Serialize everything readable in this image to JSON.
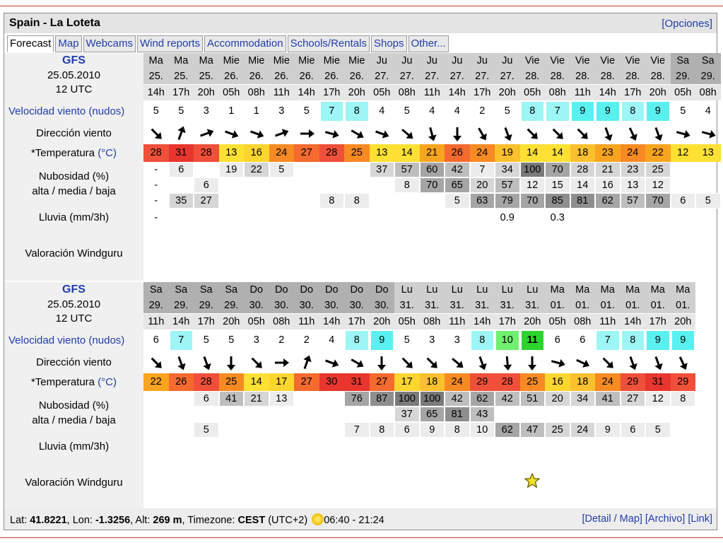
{
  "page": {
    "title": "Spain - La Loteta",
    "options_link": "[Opciones]"
  },
  "tabs": [
    "Forecast",
    "Map",
    "Webcams",
    "Wind reports",
    "Accommodation",
    "Schools/Rentals",
    "Shops",
    "Other..."
  ],
  "labels": {
    "speed": "Velocidad viento (nudos)",
    "direction": "Dirección viento",
    "temp_prefix": "*Temperatura ",
    "temp_unit": "(°C)",
    "cloud1": "Nubosidad (%)",
    "cloud2": "alta / media / baja",
    "rain": "Lluvia (mm/3h)",
    "rating": "Valoración Windguru"
  },
  "colors": {
    "link": "#1f3cab",
    "header_weekday": "#cfcfcf",
    "header_weekend": "#b0b0b0",
    "label_bg": "#f0f0f0"
  },
  "blocks": [
    {
      "model": "GFS",
      "date": "25.05.2010",
      "utc": "12 UTC",
      "cols": [
        {
          "day": "Ma",
          "date": "25.",
          "hour": "14h",
          "we": false
        },
        {
          "day": "Ma",
          "date": "25.",
          "hour": "17h",
          "we": false
        },
        {
          "day": "Ma",
          "date": "25.",
          "hour": "20h",
          "we": false
        },
        {
          "day": "Mie",
          "date": "26.",
          "hour": "05h",
          "we": false
        },
        {
          "day": "Mie",
          "date": "26.",
          "hour": "08h",
          "we": false
        },
        {
          "day": "Mie",
          "date": "26.",
          "hour": "11h",
          "we": false
        },
        {
          "day": "Mie",
          "date": "26.",
          "hour": "14h",
          "we": false
        },
        {
          "day": "Mie",
          "date": "26.",
          "hour": "17h",
          "we": false
        },
        {
          "day": "Mie",
          "date": "26.",
          "hour": "20h",
          "we": false
        },
        {
          "day": "Ju",
          "date": "27.",
          "hour": "05h",
          "we": false
        },
        {
          "day": "Ju",
          "date": "27.",
          "hour": "08h",
          "we": false
        },
        {
          "day": "Ju",
          "date": "27.",
          "hour": "11h",
          "we": false
        },
        {
          "day": "Ju",
          "date": "27.",
          "hour": "14h",
          "we": false
        },
        {
          "day": "Ju",
          "date": "27.",
          "hour": "17h",
          "we": false
        },
        {
          "day": "Ju",
          "date": "27.",
          "hour": "20h",
          "we": false
        },
        {
          "day": "Vie",
          "date": "28.",
          "hour": "05h",
          "we": false
        },
        {
          "day": "Vie",
          "date": "28.",
          "hour": "08h",
          "we": false
        },
        {
          "day": "Vie",
          "date": "28.",
          "hour": "11h",
          "we": false
        },
        {
          "day": "Vie",
          "date": "28.",
          "hour": "14h",
          "we": false
        },
        {
          "day": "Vie",
          "date": "28.",
          "hour": "17h",
          "we": false
        },
        {
          "day": "Vie",
          "date": "28.",
          "hour": "20h",
          "we": false
        },
        {
          "day": "Sa",
          "date": "29.",
          "hour": "05h",
          "we": true
        },
        {
          "day": "Sa",
          "date": "29.",
          "hour": "08h",
          "we": true
        }
      ],
      "speed": [
        "5",
        "5",
        "3",
        "1",
        "1",
        "3",
        "5",
        "7",
        "8",
        "4",
        "5",
        "4",
        "4",
        "2",
        "5",
        "8",
        "7",
        "9",
        "9",
        "8",
        "9",
        "5",
        "4"
      ],
      "dir": [
        135,
        20,
        70,
        110,
        110,
        70,
        90,
        105,
        120,
        110,
        130,
        165,
        180,
        150,
        160,
        135,
        135,
        135,
        160,
        155,
        160,
        105,
        105
      ],
      "temp": [
        "28",
        "31",
        "28",
        "13",
        "16",
        "24",
        "27",
        "28",
        "25",
        "13",
        "14",
        "21",
        "26",
        "24",
        "19",
        "14",
        "14",
        "18",
        "23",
        "24",
        "22",
        "12",
        "13"
      ],
      "cloud_high": [
        "-",
        "6",
        "",
        "19",
        "22",
        "5",
        "",
        "",
        "",
        "37",
        "57",
        "60",
        "42",
        "7",
        "34",
        "100",
        "70",
        "28",
        "21",
        "23",
        "25",
        "",
        ""
      ],
      "cloud_mid": [
        "-",
        "",
        "6",
        "",
        "",
        "",
        "",
        "",
        "",
        "",
        "8",
        "70",
        "65",
        "20",
        "57",
        "12",
        "15",
        "14",
        "16",
        "13",
        "12",
        "",
        ""
      ],
      "cloud_low": [
        "-",
        "35",
        "27",
        "",
        "",
        "",
        "",
        "8",
        "8",
        "",
        "",
        "",
        "5",
        "63",
        "79",
        "70",
        "85",
        "81",
        "62",
        "57",
        "70",
        "6",
        "5"
      ],
      "rain": [
        "-",
        "",
        "",
        "",
        "",
        "",
        "",
        "",
        "",
        "",
        "",
        "",
        "",
        "",
        "0.9",
        "",
        "0.3",
        "",
        "",
        "",
        "",
        "",
        ""
      ],
      "rating": [
        "",
        "",
        "",
        "",
        "",
        "",
        "",
        "",
        "",
        "",
        "",
        "",
        "",
        "",
        "",
        "",
        "",
        "",
        "",
        "",
        "",
        "",
        ""
      ]
    },
    {
      "model": "GFS",
      "date": "25.05.2010",
      "utc": "12 UTC",
      "cols": [
        {
          "day": "Sa",
          "date": "29.",
          "hour": "11h",
          "we": true
        },
        {
          "day": "Sa",
          "date": "29.",
          "hour": "14h",
          "we": true
        },
        {
          "day": "Sa",
          "date": "29.",
          "hour": "17h",
          "we": true
        },
        {
          "day": "Sa",
          "date": "29.",
          "hour": "20h",
          "we": true
        },
        {
          "day": "Do",
          "date": "30.",
          "hour": "05h",
          "we": true
        },
        {
          "day": "Do",
          "date": "30.",
          "hour": "08h",
          "we": true
        },
        {
          "day": "Do",
          "date": "30.",
          "hour": "11h",
          "we": true
        },
        {
          "day": "Do",
          "date": "30.",
          "hour": "14h",
          "we": true
        },
        {
          "day": "Do",
          "date": "30.",
          "hour": "17h",
          "we": true
        },
        {
          "day": "Do",
          "date": "30.",
          "hour": "20h",
          "we": true
        },
        {
          "day": "Lu",
          "date": "31.",
          "hour": "05h",
          "we": false
        },
        {
          "day": "Lu",
          "date": "31.",
          "hour": "08h",
          "we": false
        },
        {
          "day": "Lu",
          "date": "31.",
          "hour": "11h",
          "we": false
        },
        {
          "day": "Lu",
          "date": "31.",
          "hour": "14h",
          "we": false
        },
        {
          "day": "Lu",
          "date": "31.",
          "hour": "17h",
          "we": false
        },
        {
          "day": "Lu",
          "date": "31.",
          "hour": "20h",
          "we": false
        },
        {
          "day": "Ma",
          "date": "01.",
          "hour": "05h",
          "we": false
        },
        {
          "day": "Ma",
          "date": "01.",
          "hour": "08h",
          "we": false
        },
        {
          "day": "Ma",
          "date": "01.",
          "hour": "11h",
          "we": false
        },
        {
          "day": "Ma",
          "date": "01.",
          "hour": "14h",
          "we": false
        },
        {
          "day": "Ma",
          "date": "01.",
          "hour": "17h",
          "we": false
        },
        {
          "day": "Ma",
          "date": "01.",
          "hour": "20h",
          "we": false
        }
      ],
      "speed": [
        "6",
        "7",
        "5",
        "5",
        "3",
        "2",
        "2",
        "4",
        "8",
        "9",
        "5",
        "3",
        "3",
        "8",
        "10",
        "11",
        "6",
        "6",
        "7",
        "8",
        "9",
        "9"
      ],
      "dir": [
        135,
        160,
        160,
        180,
        135,
        90,
        20,
        110,
        120,
        180,
        135,
        135,
        130,
        160,
        175,
        180,
        105,
        115,
        135,
        160,
        160,
        155
      ],
      "temp": [
        "22",
        "26",
        "28",
        "25",
        "14",
        "17",
        "27",
        "30",
        "31",
        "27",
        "17",
        "18",
        "24",
        "29",
        "28",
        "25",
        "16",
        "18",
        "24",
        "29",
        "31",
        "29"
      ],
      "cloud_high": [
        "",
        "",
        "6",
        "41",
        "21",
        "13",
        "",
        "",
        "76",
        "87",
        "100",
        "100",
        "42",
        "62",
        "42",
        "51",
        "20",
        "34",
        "41",
        "27",
        "12",
        "8"
      ],
      "cloud_mid": [
        "",
        "",
        "",
        "",
        "",
        "",
        "",
        "",
        "",
        "",
        "37",
        "65",
        "81",
        "43",
        "",
        "",
        "",
        "",
        "",
        "",
        "",
        ""
      ],
      "cloud_low": [
        "",
        "",
        "5",
        "",
        "",
        "",
        "",
        "",
        "7",
        "8",
        "6",
        "9",
        "8",
        "10",
        "62",
        "47",
        "25",
        "24",
        "9",
        "6",
        "5",
        ""
      ],
      "rain": [
        "",
        "",
        "",
        "",
        "",
        "",
        "",
        "",
        "",
        "",
        "",
        "",
        "",
        "",
        "",
        "",
        "",
        "",
        "",
        "",
        "",
        ""
      ],
      "rating": [
        "",
        "",
        "",
        "",
        "",
        "",
        "",
        "",
        "",
        "",
        "",
        "",
        "",
        "",
        "",
        "1",
        "",
        "",
        "",
        "",
        "",
        ""
      ]
    }
  ],
  "footer": {
    "lat_label": "Lat: ",
    "lat": "41.8221",
    "lon_label": ", Lon: ",
    "lon": "-1.3256",
    "alt_label": ", Alt: ",
    "alt": "269 m",
    "tz_label": ", Timezone: ",
    "tz": "CEST",
    "tz_offset": " (UTC+2)",
    "sun_times": "06:40 - 21:24",
    "links": [
      "[Detail / Map]",
      "[Archivo]",
      "[Link]"
    ]
  }
}
